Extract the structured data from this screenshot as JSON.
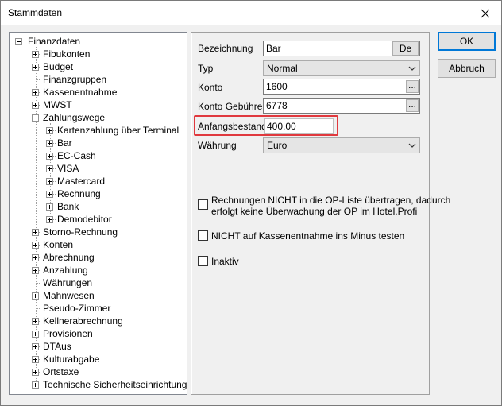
{
  "window": {
    "title": "Stammdaten"
  },
  "tree": {
    "root": "Finanzdaten",
    "items": [
      "Fibukonten",
      "Budget",
      "Finanzgruppen",
      "Kassenentnahme",
      "MWST",
      "Zahlungswege",
      "Kartenzahlung über Terminal",
      "Bar",
      "EC-Cash",
      "VISA",
      "Mastercard",
      "Rechnung",
      "Bank",
      "Demodebitor",
      "Storno-Rechnung",
      "Konten",
      "Abrechnung",
      "Anzahlung",
      "Währungen",
      "Mahnwesen",
      "Pseudo-Zimmer",
      "Kellnerabrechnung",
      "Provisionen",
      "DTAus",
      "Kulturabgabe",
      "Ortstaxe",
      "Technische Sicherheitseinrichtung"
    ]
  },
  "form": {
    "bezeichnung_label": "Bezeichnung",
    "bezeichnung_value": "Bar",
    "lang_button": "De",
    "typ_label": "Typ",
    "typ_value": "Normal",
    "konto_label": "Konto",
    "konto_value": "1600",
    "konto_geb_label": "Konto Gebühren",
    "konto_geb_value": "6778",
    "browse_label": "...",
    "anfangsbestand_label": "Anfangsbestand",
    "anfangsbestand_value": "400.00",
    "waehrung_label": "Währung",
    "waehrung_value": "Euro",
    "cb_op_liste_line1": "Rechnungen NICHT in die OP-Liste übertragen, dadurch",
    "cb_op_liste_line2": "erfolgt keine Überwachung der OP im Hotel.Profi",
    "cb_minus": "NICHT auf Kassenentnahme ins Minus testen",
    "cb_inaktiv": "Inaktiv"
  },
  "buttons": {
    "ok": "OK",
    "abbruch": "Abbruch"
  },
  "colors": {
    "highlight": "#e0393e",
    "accent": "#0078d7"
  }
}
